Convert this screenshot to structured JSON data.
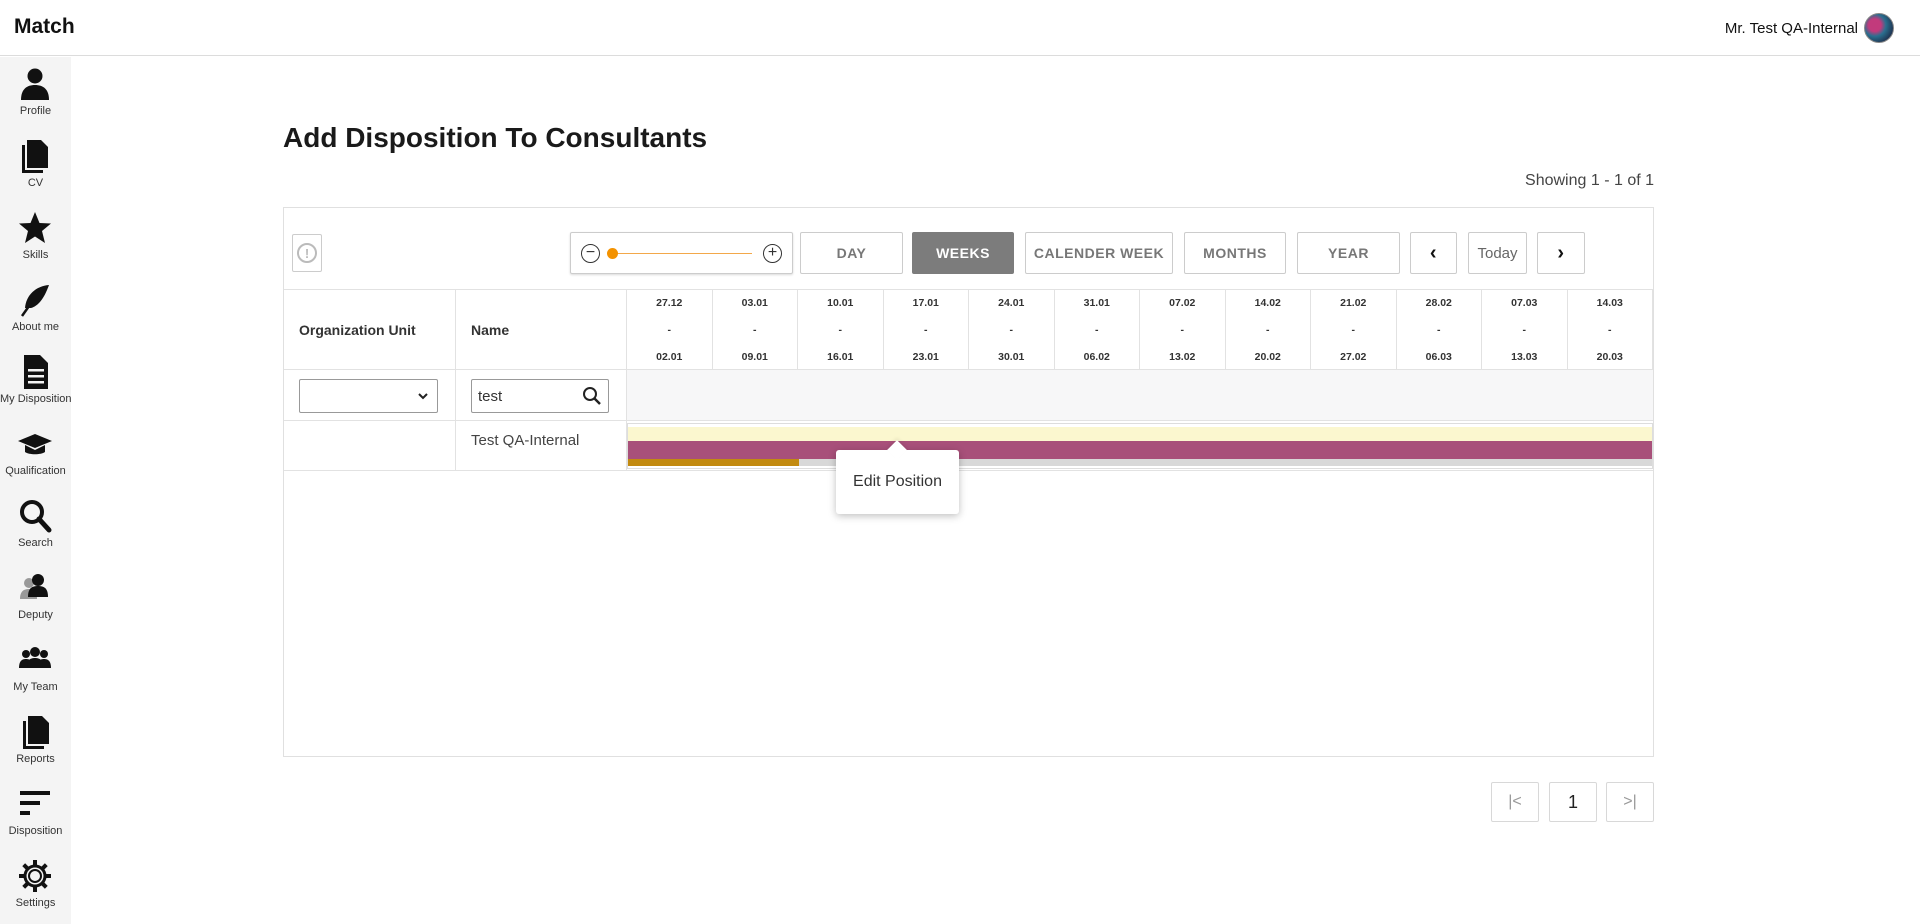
{
  "app": {
    "title": "Match",
    "user_name": "Mr. Test QA-Internal"
  },
  "sidebar": {
    "items": [
      {
        "label": "Profile",
        "icon": "person-icon"
      },
      {
        "label": "CV",
        "icon": "document-icon"
      },
      {
        "label": "Skills",
        "icon": "star-icon"
      },
      {
        "label": "About me",
        "icon": "feather-icon"
      },
      {
        "label": "My Disposition",
        "icon": "file-text-icon"
      },
      {
        "label": "Qualification",
        "icon": "graduation-cap-icon"
      },
      {
        "label": "Search",
        "icon": "search-icon"
      },
      {
        "label": "Deputy",
        "icon": "user-shadow-icon"
      },
      {
        "label": "My Team",
        "icon": "team-icon"
      },
      {
        "label": "Reports",
        "icon": "documents-icon"
      },
      {
        "label": "Disposition",
        "icon": "bars-icon"
      },
      {
        "label": "Settings",
        "icon": "gear-icon"
      }
    ]
  },
  "page": {
    "title": "Add Disposition To Consultants",
    "showing": "Showing 1 - 1 of 1"
  },
  "toolbar": {
    "zoom_level": 0.0,
    "views": [
      "DAY",
      "WEEKS",
      "CALENDER WEEK",
      "MONTHS",
      "YEAR"
    ],
    "active_view": "WEEKS",
    "prev": "‹",
    "today": "Today",
    "next": "›"
  },
  "table": {
    "col_org": "Organization Unit",
    "col_name": "Name",
    "weeks": [
      {
        "start": "27.12",
        "sep": "-",
        "end": "02.01"
      },
      {
        "start": "03.01",
        "sep": "-",
        "end": "09.01"
      },
      {
        "start": "10.01",
        "sep": "-",
        "end": "16.01"
      },
      {
        "start": "17.01",
        "sep": "-",
        "end": "23.01"
      },
      {
        "start": "24.01",
        "sep": "-",
        "end": "30.01"
      },
      {
        "start": "31.01",
        "sep": "-",
        "end": "06.02"
      },
      {
        "start": "07.02",
        "sep": "-",
        "end": "13.02"
      },
      {
        "start": "14.02",
        "sep": "-",
        "end": "20.02"
      },
      {
        "start": "21.02",
        "sep": "-",
        "end": "27.02"
      },
      {
        "start": "28.02",
        "sep": "-",
        "end": "06.03"
      },
      {
        "start": "07.03",
        "sep": "-",
        "end": "13.03"
      },
      {
        "start": "14.03",
        "sep": "-",
        "end": "20.03"
      }
    ],
    "filter": {
      "org_value": "",
      "name_value": "test"
    },
    "rows": [
      {
        "org": "",
        "name": "Test QA-Internal"
      }
    ]
  },
  "gantt_colors": {
    "availability": "#fbf7cf",
    "position": "#a8507a",
    "booked": "#c28a10",
    "track": "#d8d8d8"
  },
  "tooltip": {
    "label": "Edit Position"
  },
  "pagination": {
    "first": "|<",
    "page": "1",
    "last": ">|"
  }
}
